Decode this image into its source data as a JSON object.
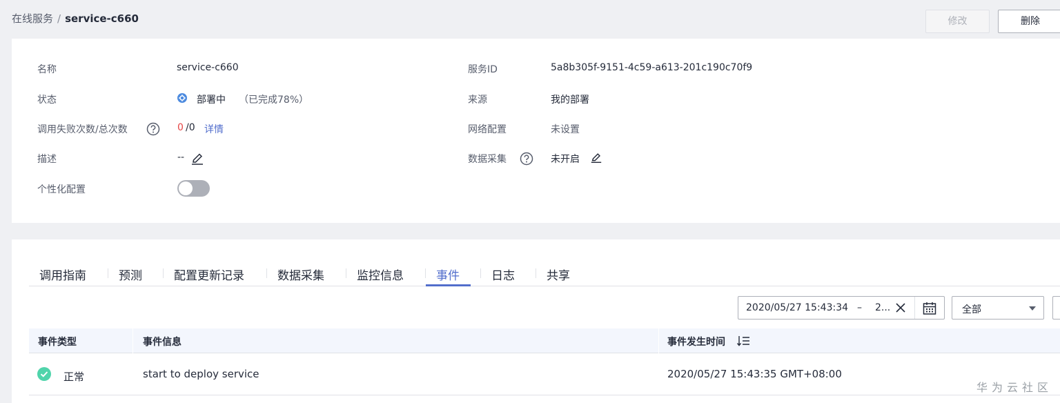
{
  "breadcrumb": {
    "parent": "在线服务",
    "separator": "/",
    "current": "service-c660"
  },
  "header_actions": {
    "edit_label": "修改",
    "delete_label": "删除"
  },
  "info": {
    "name": {
      "label": "名称",
      "value": "service-c660"
    },
    "status": {
      "label": "状态",
      "value": "部署中",
      "progress_text": "（已完成78%）",
      "progress": 0.78
    },
    "calls": {
      "label": "调用失败次数/总次数",
      "failed": "0",
      "total": "/0",
      "detail_link": "详情"
    },
    "description": {
      "label": "描述",
      "value": "--"
    },
    "personalization": {
      "label": "个性化配置",
      "enabled": false
    },
    "service_id": {
      "label": "服务ID",
      "value": "5a8b305f-9151-4c59-a613-201c190c70f9"
    },
    "source": {
      "label": "来源",
      "value": "我的部署"
    },
    "network": {
      "label": "网络配置",
      "value": "未设置"
    },
    "data_collection": {
      "label": "数据采集",
      "value": "未开启"
    }
  },
  "tabs": [
    {
      "label": "调用指南"
    },
    {
      "label": "预测"
    },
    {
      "label": "配置更新记录"
    },
    {
      "label": "数据采集"
    },
    {
      "label": "监控信息"
    },
    {
      "label": "事件",
      "active": true
    },
    {
      "label": "日志"
    },
    {
      "label": "共享"
    }
  ],
  "filters": {
    "date_start": "2020/05/27 15:43:34",
    "date_sep": "–",
    "date_end": "2...",
    "type_select": "全部"
  },
  "table": {
    "columns": [
      "事件类型",
      "事件信息",
      "事件发生时间"
    ],
    "rows": [
      {
        "type": "正常",
        "info": "start to deploy service",
        "time": "2020/05/27 15:43:35 GMT+08:00"
      }
    ]
  },
  "watermark": "华为云社区",
  "colors": {
    "accent": "#526ecc",
    "status_blue": "#4d8bdf",
    "ok_green": "#50d4ab",
    "fail_red": "#e54545"
  }
}
